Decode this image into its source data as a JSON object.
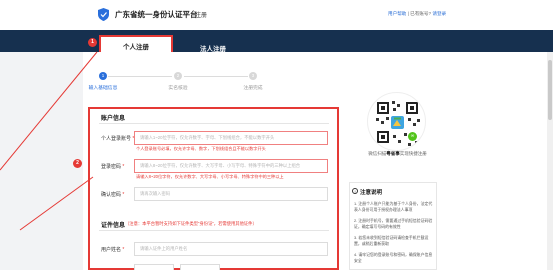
{
  "header": {
    "site_title": "广东省统一身份认证平台",
    "page_tag": "注册",
    "links": {
      "help": "用户帮助",
      "separator1": " | ",
      "has_account": "已有账号?",
      "login": "请登录"
    }
  },
  "tabs": [
    {
      "label": "个人注册",
      "active": true
    },
    {
      "label": "法人注册",
      "active": false
    }
  ],
  "steps": [
    {
      "label": "输入基础信息",
      "index": "1",
      "active": true
    },
    {
      "label": "实名核验",
      "index": "2",
      "active": false
    },
    {
      "label": "注册完成",
      "index": "3",
      "active": false
    }
  ],
  "account_section": {
    "title": "账户信息",
    "fields": [
      {
        "label": "个人登录账号",
        "required": "*",
        "placeholder": "请输入1~20位字符，仅允许数字、字母、下划线组合，不能以数字开头",
        "error": "个人登录账号必填，仅允许字母、数字，下划线组合且不能以数字开头"
      },
      {
        "label": "登录密码",
        "required": "*",
        "placeholder": "请输入8~20位字符，仅允许数字、大写字母、小写字母、特殊字符中的三种以上组合",
        "error": "请输入8~20位字符，仅允许数字、大写字母、小写字母、特殊字符中的三种以上"
      },
      {
        "label": "确认密码",
        "required": "*",
        "placeholder": "请再次输入密码"
      }
    ]
  },
  "id_section": {
    "title": "证件信息",
    "note": "（注意：本平台暂时支持如下证件类型“身份证”，若需使用其他证件）",
    "fields": [
      {
        "label": "用户姓名",
        "required": "*",
        "placeholder": "请输入证件上的用户姓名"
      }
    ]
  },
  "qr": {
    "caption_prefix": "微信扫描",
    "caption_highlight": "粤省事",
    "caption_suffix": "实现快捷注册"
  },
  "notes": {
    "icon": "info-icon",
    "title": "注意说明",
    "items": [
      "1. 注册个人账户只能为基于个人身份，法定代表人身份可用于授权办理法人事项",
      "2. 注册时手机号，需要通过手机短信验证码验证，确定填写号码的有效性",
      "3. 若您未收到短信验证码请检查手机拦截设置，或稍后重新获取",
      "4. 请牢记您的登录账号和密码，确保账户信息安全"
    ]
  },
  "callouts": [
    "1",
    "2"
  ],
  "colors": {
    "brand_blue": "#2a6fdb",
    "header_dark": "#16304f",
    "annotation_red": "#e53935"
  }
}
